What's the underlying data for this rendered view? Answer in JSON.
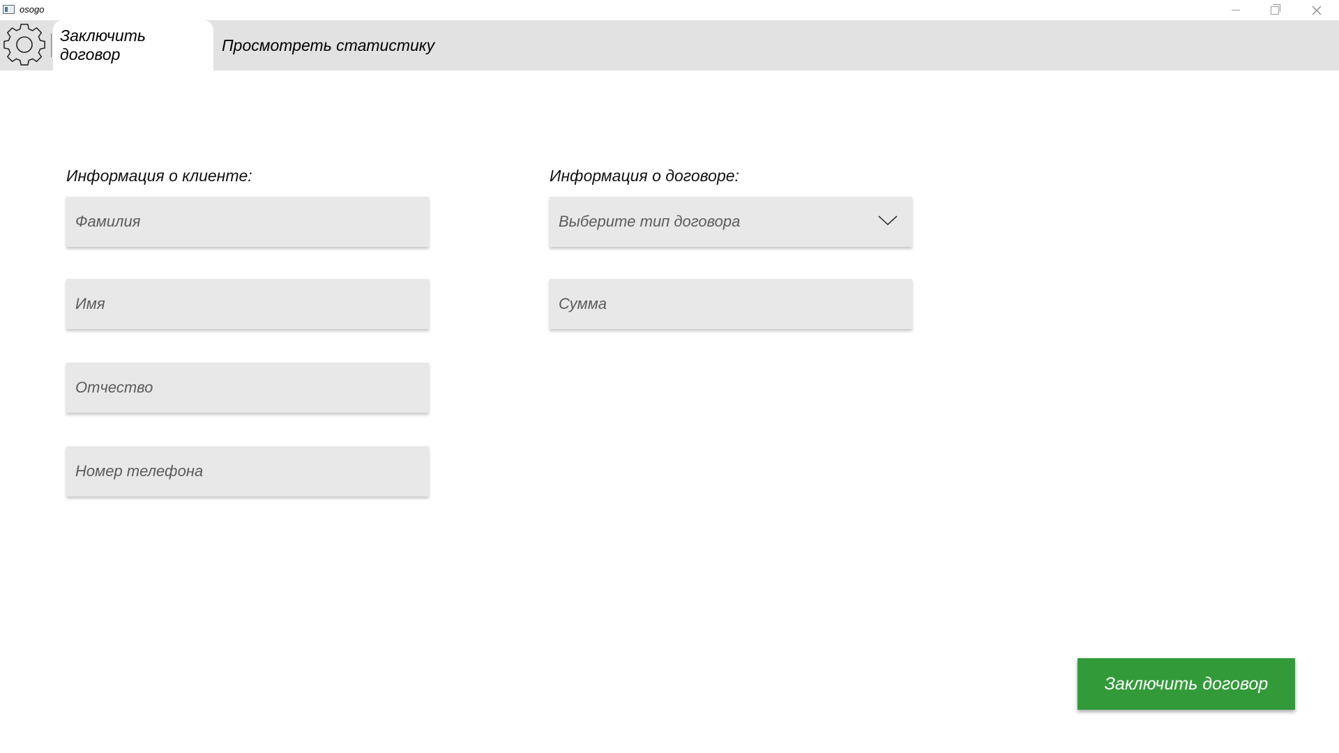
{
  "window": {
    "title": "osogo",
    "minimize_icon": "minimize-icon",
    "maximize_icon": "restore-icon",
    "close_icon": "close-icon"
  },
  "toolbar": {
    "settings_icon": "gear-icon"
  },
  "tabs": [
    {
      "label": "Заключить договор",
      "active": true
    },
    {
      "label": "Просмотреть статистику",
      "active": false
    }
  ],
  "client_section": {
    "label": "Информация о клиенте:",
    "fields": [
      {
        "placeholder": "Фамилия",
        "value": ""
      },
      {
        "placeholder": "Имя",
        "value": ""
      },
      {
        "placeholder": "Отчество",
        "value": ""
      },
      {
        "placeholder": "Номер телефона",
        "value": ""
      }
    ]
  },
  "contract_section": {
    "label": "Информация о договоре:",
    "type_select": {
      "placeholder": "Выберите тип договора",
      "icon": "chevron-down-icon"
    },
    "amount": {
      "placeholder": "Сумма",
      "value": ""
    }
  },
  "submit_button": {
    "label": "Заключить договор",
    "color": "#339a3a"
  }
}
